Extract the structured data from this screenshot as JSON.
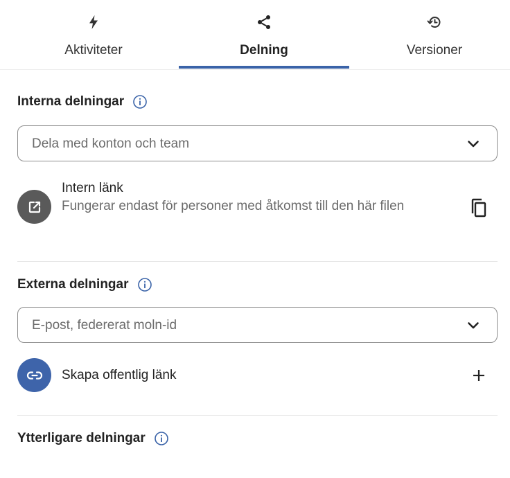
{
  "tabs": [
    {
      "label": "Aktiviteter",
      "icon": "lightning-icon",
      "active": false
    },
    {
      "label": "Delning",
      "icon": "share-icon",
      "active": true
    },
    {
      "label": "Versioner",
      "icon": "history-icon",
      "active": false
    }
  ],
  "internal": {
    "title": "Interna delningar",
    "search_placeholder": "Dela med konton och team",
    "link_title": "Intern länk",
    "link_desc": "Fungerar endast för personer med åtkomst till den här filen"
  },
  "external": {
    "title": "Externa delningar",
    "search_placeholder": "E-post, federerat moln-id",
    "public_link_label": "Skapa offentlig länk"
  },
  "additional": {
    "title": "Ytterligare delningar"
  },
  "colors": {
    "accent": "#3a63a8",
    "avatar_grey": "#5a5a5a",
    "avatar_blue": "#3e64aa"
  }
}
